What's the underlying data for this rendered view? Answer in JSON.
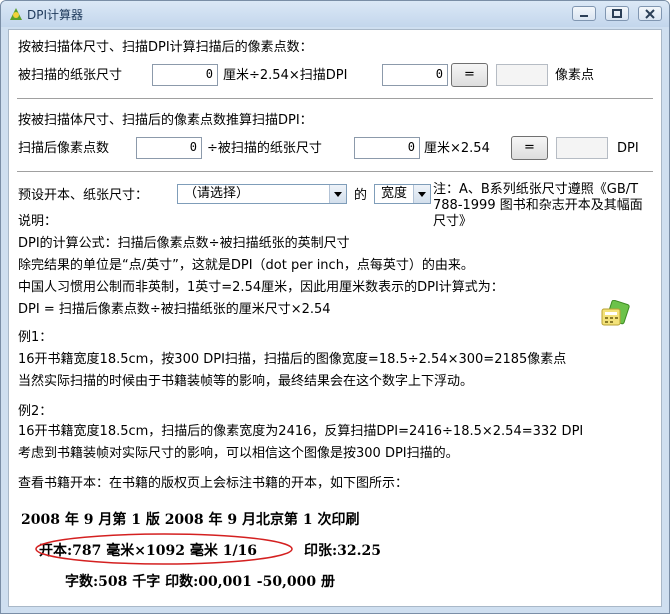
{
  "window": {
    "title": "DPI计算器"
  },
  "section1": {
    "heading": "按被扫描体尺寸、扫描DPI计算扫描后的像素点数：",
    "label_size": "被扫描的纸张尺寸",
    "size_value": "0",
    "op_text": "厘米÷2.54×扫描DPI",
    "dpi_value": "0",
    "equals_label": "=",
    "result_value": "",
    "unit": "像素点"
  },
  "section2": {
    "heading": "按被扫描体尺寸、扫描后的像素点数推算扫描DPI：",
    "label_pixels": "扫描后像素点数",
    "pixels_value": "0",
    "div_text": "÷被扫描的纸张尺寸",
    "size_value": "0",
    "op_text": "厘米×2.54",
    "equals_label": "=",
    "result_value": "",
    "unit": "DPI"
  },
  "preset": {
    "label": "预设开本、纸张尺寸：",
    "selected": "（请选择）",
    "de": "的",
    "dimension": "宽度",
    "note": "注：A、B系列纸张尺寸遵照《GB/T 788-1999 图书和杂志开本及其幅面尺寸》"
  },
  "explain": {
    "l1": "说明：",
    "l2": "DPI的计算公式：扫描后像素点数÷被扫描纸张的英制尺寸",
    "l3": "除完结果的单位是“点/英寸”，这就是DPI（dot per inch，点每英寸）的由来。",
    "l4": "中国人习惯用公制而非英制，1英寸=2.54厘米，因此用厘米数表示的DPI计算式为：",
    "l5": "DPI = 扫描后像素点数÷被扫描纸张的厘米尺寸×2.54",
    "ex1_title": "例1：",
    "ex1_l1": "16开书籍宽度18.5cm，按300 DPI扫描，扫描后的图像宽度=18.5÷2.54×300=2185像素点",
    "ex1_l2": "当然实际扫描的时候由于书籍装帧等的影响，最终结果会在这个数字上下浮动。",
    "ex2_title": "例2：",
    "ex2_l1": "16开书籍宽度18.5cm，扫描后的像素宽度为2416，反算扫描DPI=2416÷18.5×2.54=332 DPI",
    "ex2_l2": "考虑到书籍装帧对实际尺寸的影响，可以相信这个图像是按300 DPI扫描的。",
    "view_note": "查看书籍开本：在书籍的版权页上会标注书籍的开本，如下图所示："
  },
  "book_sample": {
    "line1": "2008 年 9 月第 1 版    2008 年 9 月北京第 1 次印刷",
    "line2a": "开本:787 毫米×1092 毫米   1/16",
    "line2b": "印张:32.25",
    "line3": "字数:508 千字    印数:00,001 -50,000 册"
  },
  "colors": {
    "accent_oval": "#d42020",
    "title_text": "#1e395b"
  }
}
